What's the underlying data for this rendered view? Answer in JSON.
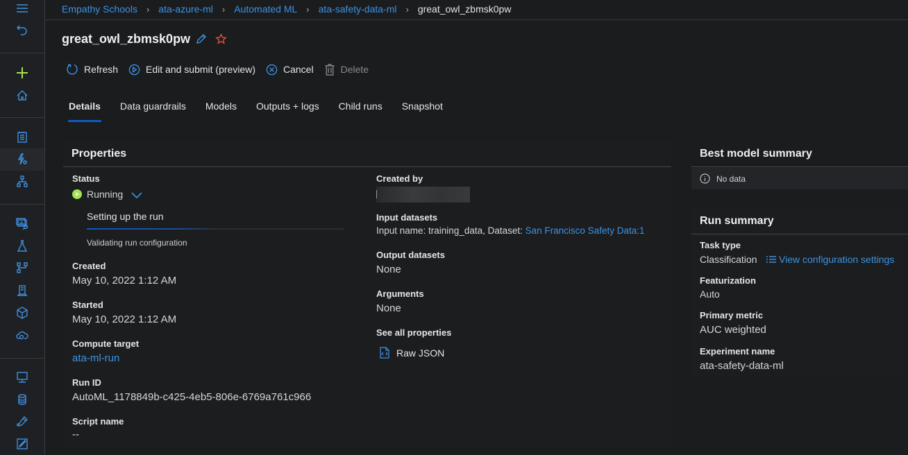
{
  "nav_rail": {
    "items": [
      {
        "name": "menu",
        "icon": "hamburger-icon"
      },
      {
        "name": "back",
        "icon": "undo-icon"
      },
      {
        "name": "new",
        "icon": "plus-icon"
      },
      {
        "name": "home",
        "icon": "home-icon"
      },
      {
        "name": "notebooks",
        "icon": "notebook-icon"
      },
      {
        "name": "automated-ml",
        "icon": "automl-icon",
        "active": true
      },
      {
        "name": "designer",
        "icon": "hierarchy-icon"
      },
      {
        "name": "data",
        "icon": "data-search-icon"
      },
      {
        "name": "experiments",
        "icon": "flask-icon"
      },
      {
        "name": "pipelines",
        "icon": "pipeline-icon"
      },
      {
        "name": "models",
        "icon": "model-icon"
      },
      {
        "name": "endpoints",
        "icon": "cube-icon"
      },
      {
        "name": "cloud",
        "icon": "cloud-icon"
      },
      {
        "name": "compute",
        "icon": "monitor-icon"
      },
      {
        "name": "datastores",
        "icon": "database-icon"
      },
      {
        "name": "data-labeling",
        "icon": "pen-icon"
      },
      {
        "name": "linked-services",
        "icon": "edit-box-icon"
      }
    ]
  },
  "breadcrumb": [
    {
      "label": "Empathy Schools"
    },
    {
      "label": "ata-azure-ml"
    },
    {
      "label": "Automated ML"
    },
    {
      "label": "ata-safety-data-ml"
    },
    {
      "label": "great_owl_zbmsk0pw",
      "current": true
    }
  ],
  "breadcrumb_separator": "›",
  "header": {
    "title": "great_owl_zbmsk0pw"
  },
  "toolbar": {
    "refresh": "Refresh",
    "edit_submit": "Edit and submit (preview)",
    "cancel": "Cancel",
    "delete": "Delete"
  },
  "tabs": [
    {
      "label": "Details",
      "active": true
    },
    {
      "label": "Data guardrails"
    },
    {
      "label": "Models"
    },
    {
      "label": "Outputs + logs"
    },
    {
      "label": "Child runs"
    },
    {
      "label": "Snapshot"
    }
  ],
  "properties": {
    "title": "Properties",
    "status": {
      "label": "Status",
      "value": "Running",
      "step": "Setting up the run",
      "step_progress_percent": 25,
      "substep": "Validating run configuration",
      "color": "#a4e34f"
    },
    "created": {
      "label": "Created",
      "value": "May 10, 2022 1:12 AM"
    },
    "started": {
      "label": "Started",
      "value": "May 10, 2022 1:12 AM"
    },
    "compute_target": {
      "label": "Compute target",
      "value": "ata-ml-run"
    },
    "run_id": {
      "label": "Run ID",
      "value": "AutoML_1178849b-c425-4eb5-806e-6769a761c966"
    },
    "script_name": {
      "label": "Script name",
      "value": "--"
    },
    "created_by": {
      "label": "Created by",
      "value": ""
    },
    "input_datasets": {
      "label": "Input datasets",
      "prefix": "Input name: training_data, Dataset: ",
      "dataset_link": "San Francisco Safety Data:1"
    },
    "output_datasets": {
      "label": "Output datasets",
      "value": "None"
    },
    "arguments": {
      "label": "Arguments",
      "value": "None"
    },
    "see_all": {
      "label": "See all properties",
      "raw_json": "Raw JSON"
    }
  },
  "best_model_summary": {
    "title": "Best model summary",
    "empty_text": "No data"
  },
  "run_summary": {
    "title": "Run summary",
    "task_type": {
      "label": "Task type",
      "value": "Classification"
    },
    "view_config": "View configuration settings",
    "featurization": {
      "label": "Featurization",
      "value": "Auto"
    },
    "primary_metric": {
      "label": "Primary metric",
      "value": "AUC weighted"
    },
    "experiment_name": {
      "label": "Experiment name",
      "value": "ata-safety-data-ml"
    }
  },
  "colors": {
    "accent": "#3b93e5",
    "background": "#1b1c1e",
    "tab_underline": "#0f5bc4",
    "favorite_star": "#e0503c",
    "status_running": "#a4e34f",
    "new_plus": "#a4e34f"
  }
}
